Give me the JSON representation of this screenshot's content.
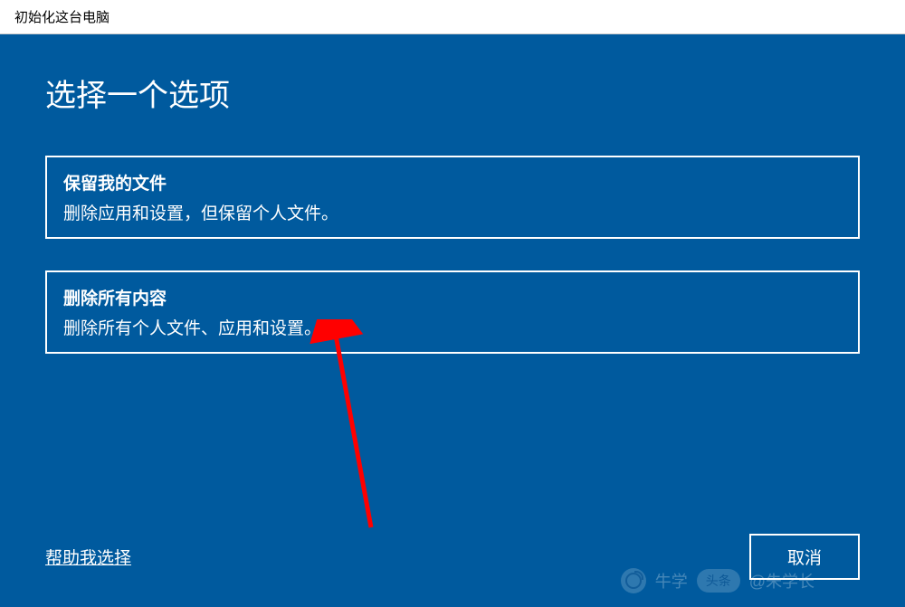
{
  "window": {
    "title": "初始化这台电脑"
  },
  "heading": "选择一个选项",
  "options": [
    {
      "title": "保留我的文件",
      "desc": "删除应用和设置，但保留个人文件。"
    },
    {
      "title": "删除所有内容",
      "desc": "删除所有个人文件、应用和设置。"
    }
  ],
  "footer": {
    "help_link": "帮助我选择",
    "cancel_label": "取消"
  },
  "watermark": {
    "text1": "牛学",
    "text2": "头条",
    "text3": "@朱学长"
  }
}
